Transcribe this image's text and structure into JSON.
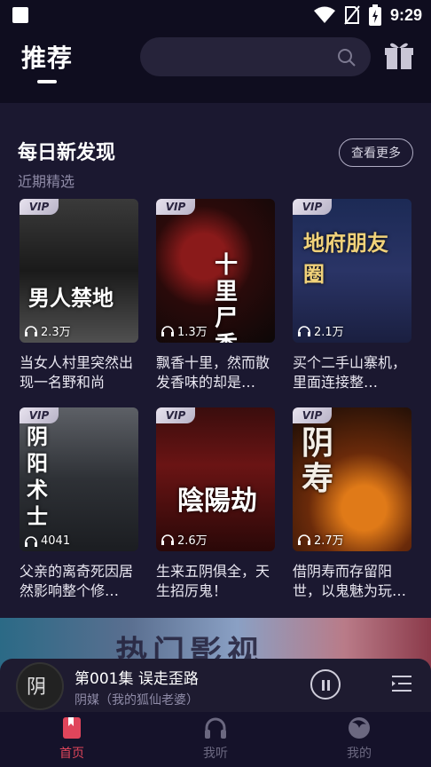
{
  "statusbar": {
    "time": "9:29"
  },
  "header": {
    "tab": "推荐"
  },
  "section": {
    "title": "每日新发现",
    "subtitle": "近期精选",
    "more": "查看更多"
  },
  "books": [
    {
      "badge": "VIP",
      "plays": "2.3万",
      "desc": "当女人村里突然出现一名野和尚",
      "cover_text": "男人禁地"
    },
    {
      "badge": "VIP",
      "plays": "1.3万",
      "desc": "飘香十里，然而散发香味的却是…",
      "cover_text": "十里尸香"
    },
    {
      "badge": "VIP",
      "plays": "2.1万",
      "desc": "买个二手山寨机，里面连接整…",
      "cover_text": "地府朋友圈"
    },
    {
      "badge": "VIP",
      "plays": "4041",
      "desc": "父亲的离奇死因居然影响整个修…",
      "cover_text": "阴阳术士"
    },
    {
      "badge": "VIP",
      "plays": "2.6万",
      "desc": "生来五阴俱全，天生招厉鬼！",
      "cover_text": "陰陽劫"
    },
    {
      "badge": "VIP",
      "plays": "2.7万",
      "desc": "借阴寿而存留阳世，以鬼魅为玩…",
      "cover_text": "阴寿"
    }
  ],
  "banner": {
    "title": "热门影视"
  },
  "player": {
    "episode": "第001集 误走歪路",
    "album": "阴媒（我的狐仙老婆）",
    "disc_text": "阴"
  },
  "nav": [
    {
      "label": "首页",
      "active": true
    },
    {
      "label": "我听",
      "active": false
    },
    {
      "label": "我的",
      "active": false
    }
  ],
  "colors": {
    "active": "#e0455b",
    "inactive": "#6b6880"
  }
}
